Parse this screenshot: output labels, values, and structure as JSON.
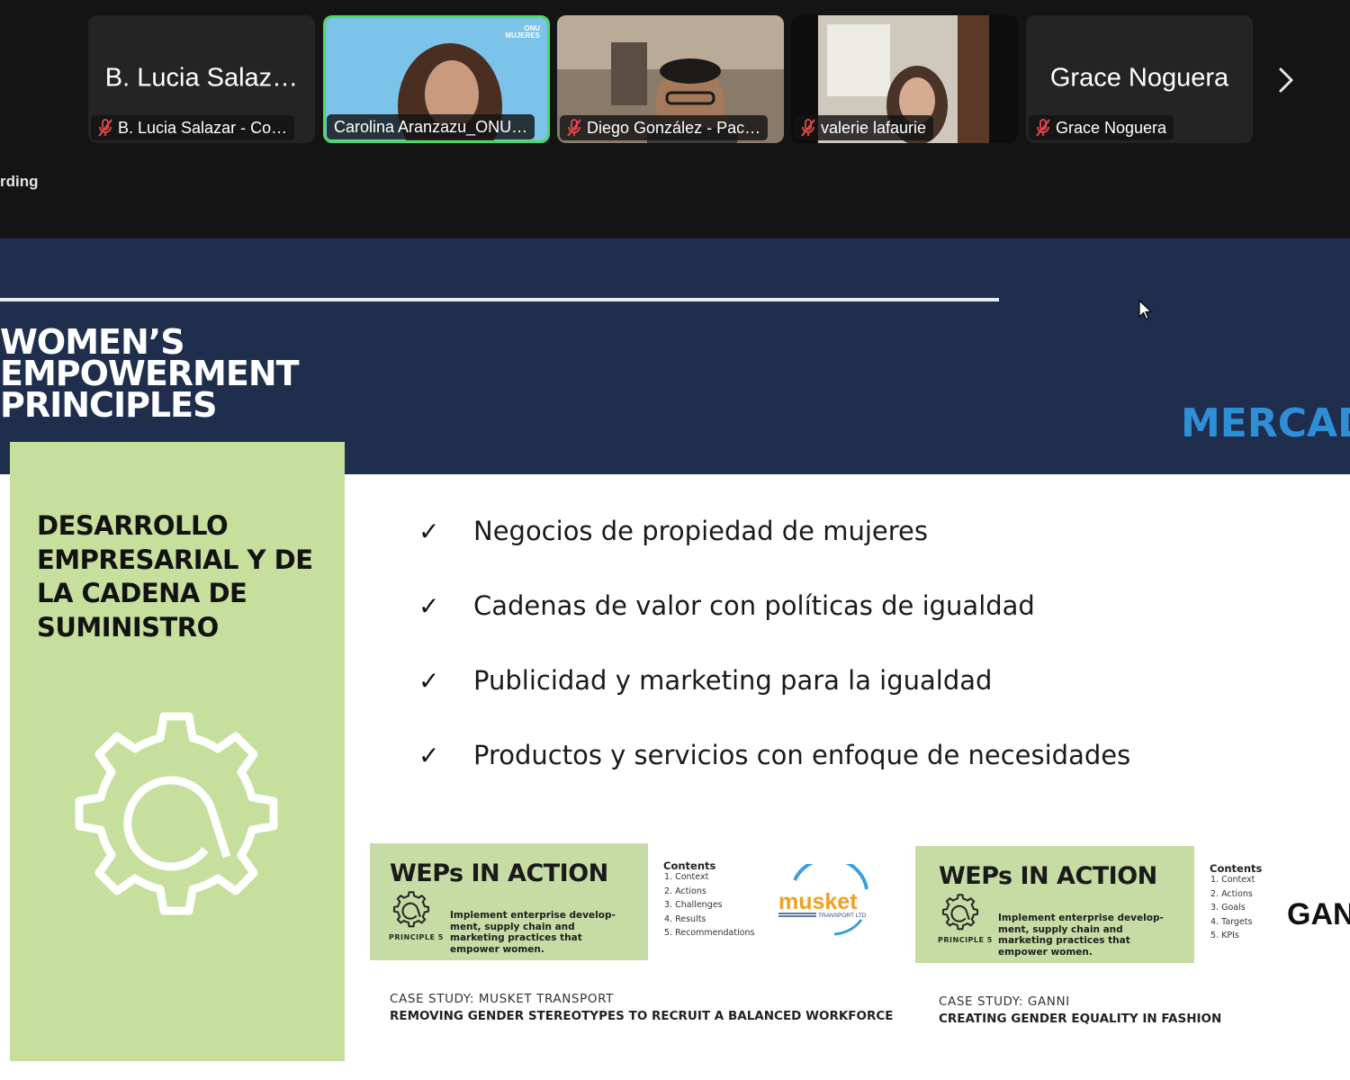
{
  "participants": [
    {
      "display_name": "B. Lucia Salaz…",
      "label": "B. Lucia Salazar - Co…",
      "muted": true,
      "video": false
    },
    {
      "display_name": "",
      "label": "Carolina Aranzazu_ONU…",
      "muted": false,
      "video": true,
      "active_speaker": true,
      "background_text": "ONU MUJERES"
    },
    {
      "display_name": "",
      "label": "Diego González - Pac…",
      "muted": true,
      "video": true
    },
    {
      "display_name": "",
      "label": "valerie lafaurie",
      "muted": true,
      "video": true
    },
    {
      "display_name": "Grace Noguera",
      "label": "Grace Noguera",
      "muted": true,
      "video": false
    }
  ],
  "recording_text": "rding",
  "icons": {
    "next_page": "chevron-right-icon",
    "mic_muted": "mic-off-icon",
    "cursor": "mouse-pointer-icon"
  },
  "slide": {
    "header_lines": [
      "WOMEN’S",
      "EMPOWERMENT",
      "PRINCIPLES"
    ],
    "partner_text": "MERCAD",
    "panel_title_lines": [
      "DESARROLLO",
      "EMPRESARIAL Y DE",
      "LA CADENA DE",
      "SUMINISTRO"
    ],
    "check_symbol": "✓",
    "checklist": [
      "Negocios de propiedad de mujeres",
      "Cadenas de valor con políticas de igualdad",
      "Publicidad y marketing para la igualdad",
      "Productos y servicios con enfoque de necesidades"
    ],
    "cards": [
      {
        "title": "WEPs IN ACTION",
        "principle": "PRINCIPLE 5",
        "description": "Implement enterprise develop-ment, supply chain and marketing practices that empower women.",
        "contents_title": "Contents",
        "contents": [
          "1.  Context",
          "2.  Actions",
          "3.  Challenges",
          "4.  Results",
          "5.  Recommendations"
        ],
        "logo_text": "musket",
        "logo_sub": "TRANSPORT LTD",
        "caption_top": "CASE STUDY: MUSKET TRANSPORT",
        "caption_bottom": "REMOVING GENDER STEREOTYPES TO RECRUIT A BALANCED WORKFORCE"
      },
      {
        "title": "WEPs IN ACTION",
        "principle": "PRINCIPLE 5",
        "description": "Implement enterprise develop-ment, supply chain and marketing practices that empower women.",
        "contents_title": "Contents",
        "contents": [
          "1.  Context",
          "2.  Actions",
          "3.  Goals",
          "4.  Targets",
          "5.  KPIs"
        ],
        "logo_text": "GAN",
        "caption_top": "CASE STUDY: GANNI",
        "caption_bottom": "CREATING GENDER EQUALITY IN FASHION"
      }
    ]
  },
  "colors": {
    "active_speaker_border": "#4cd964",
    "slide_band": "#1f2e4d",
    "panel_green": "#c7df9c",
    "partner_blue": "#2f8fd6",
    "mic_off_red": "#e5484d"
  }
}
